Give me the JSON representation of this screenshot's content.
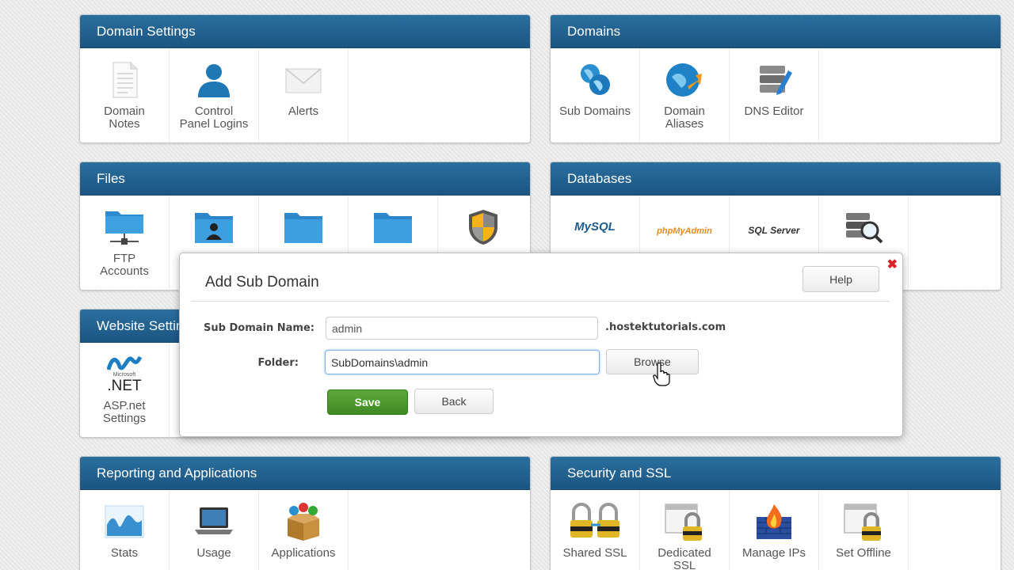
{
  "panels": {
    "domain_settings": {
      "title": "Domain Settings",
      "tiles": [
        {
          "label": "Domain\nNotes",
          "icon": "notes-icon"
        },
        {
          "label": "Control\nPanel Logins",
          "icon": "user-icon"
        },
        {
          "label": "Alerts",
          "icon": "envelope-icon"
        }
      ]
    },
    "domains": {
      "title": "Domains",
      "tiles": [
        {
          "label": "Sub Domains",
          "icon": "globes-icon"
        },
        {
          "label": "Domain\nAliases",
          "icon": "globe-arrow-icon"
        },
        {
          "label": "DNS Editor",
          "icon": "server-pencil-icon"
        }
      ]
    },
    "files": {
      "title": "Files",
      "tiles": [
        {
          "label": "FTP\nAccounts",
          "icon": "network-folder-icon"
        },
        {
          "label": "",
          "icon": "user-folder-icon"
        },
        {
          "label": "",
          "icon": "folder-icon"
        },
        {
          "label": "",
          "icon": "folder-icon"
        },
        {
          "label": "",
          "icon": "shield-icon"
        }
      ]
    },
    "databases": {
      "title": "Databases",
      "tiles": [
        {
          "label": "",
          "icon": "mysql-logo-icon"
        },
        {
          "label": "",
          "icon": "phpmyadmin-logo-icon"
        },
        {
          "label": "",
          "icon": "sqlserver-logo-icon"
        },
        {
          "label": "",
          "icon": "database-search-icon"
        }
      ]
    },
    "website_settings": {
      "title": "Website Settings",
      "tiles": [
        {
          "label": "ASP.net\nSettings",
          "icon": "dotnet-logo-icon"
        }
      ]
    },
    "reporting": {
      "title": "Reporting and Applications",
      "tiles": [
        {
          "label": "Stats",
          "icon": "chart-icon"
        },
        {
          "label": "Usage",
          "icon": "laptop-icon"
        },
        {
          "label": "Applications",
          "icon": "box-icon"
        }
      ]
    },
    "security": {
      "title": "Security and SSL",
      "tiles": [
        {
          "label": "Shared SSL",
          "icon": "padlocks-icon"
        },
        {
          "label": "Dedicated\nSSL",
          "icon": "padlock-window-icon"
        },
        {
          "label": "Manage IPs",
          "icon": "firewall-icon"
        },
        {
          "label": "Set Offline",
          "icon": "padlock-window-icon"
        }
      ]
    }
  },
  "logo_text": {
    "mysql": "MySQL",
    "phpmyadmin": "phpMyAdmin",
    "sqlserver": "SQL Server",
    "dotnet_small": "Microsoft",
    "dotnet": ".NET"
  },
  "modal": {
    "title": "Add Sub Domain",
    "help_label": "Help",
    "close_label": "✖",
    "subdomain_label": "Sub Domain Name:",
    "subdomain_value": "admin",
    "domain_suffix": ".hostektutorials.com",
    "folder_label": "Folder:",
    "folder_value": "SubDomains\\admin",
    "browse_label": "Browse",
    "save_label": "Save",
    "back_label": "Back"
  },
  "colors": {
    "header_blue": "#1c5582",
    "save_green": "#4a9a2c",
    "close_red": "#d9222a"
  }
}
